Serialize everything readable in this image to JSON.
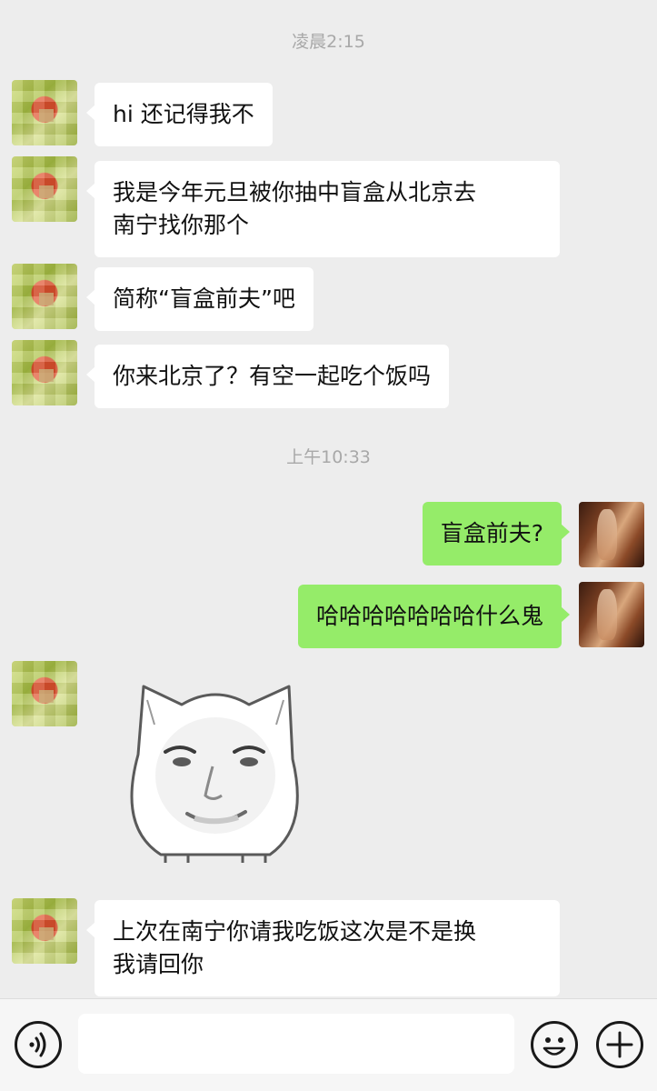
{
  "timestamps": [
    "凌晨2:15",
    "上午10:33"
  ],
  "messages": [
    {
      "side": "left",
      "text": "hi 还记得我不"
    },
    {
      "side": "left",
      "lines": [
        "我是今年元旦被你抽中盲盒从北京去",
        "南宁找你那个"
      ]
    },
    {
      "side": "left",
      "text": "简称“盲盒前夫”吧"
    },
    {
      "side": "left",
      "text": "你来北京了？有空一起吃个饭吗"
    },
    {
      "side": "right",
      "text": "盲盒前夫?"
    },
    {
      "side": "right",
      "text": "哈哈哈哈哈哈哈什么鬼"
    },
    {
      "side": "left",
      "sticker": "cat-face-meme-sticker"
    },
    {
      "side": "left",
      "lines": [
        "上次在南宁你请我吃饭这次是不是换",
        "我请回你"
      ]
    }
  ],
  "input_bar": {
    "voice_icon": "voice-icon",
    "emoji_icon": "emoji-icon",
    "plus_icon": "plus-icon",
    "input_value": ""
  },
  "colors": {
    "background": "#ededed",
    "bubble_left": "#ffffff",
    "bubble_right": "#95ec69",
    "timestamp_text": "#a8a8a8"
  }
}
